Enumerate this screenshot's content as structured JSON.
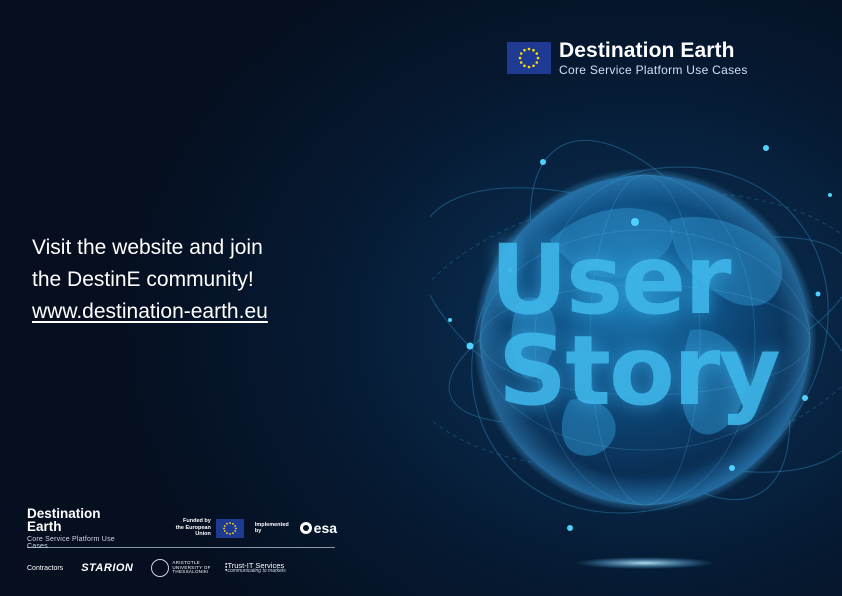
{
  "header": {
    "title": "Destination Earth",
    "subtitle": "Core Service Platform Use Cases",
    "flag_icon": "eu-flag-icon"
  },
  "cta": {
    "line1": "Visit the website and join",
    "line2": "the DestinE community!",
    "link": "www.destination-earth.eu"
  },
  "hero": {
    "word1": "User",
    "word2": "Story"
  },
  "footer": {
    "brand_title": "Destination Earth",
    "brand_subtitle": "Core Service Platform Use Cases",
    "funded_line1": "Funded by",
    "funded_line2": "the European Union",
    "implemented": "Implemented by",
    "esa": "esa",
    "contractors_label": "Contractors",
    "starion": "STARION",
    "auth_line1": "ARISTOTLE",
    "auth_line2": "UNIVERSITY OF",
    "auth_line3": "THESSALONIKI",
    "trust_name": "Trust-IT Services",
    "trust_tagline": "communicating to markets"
  },
  "colors": {
    "background": "#061324",
    "accent": "#3fb8ec",
    "eu_blue": "#1f3a93",
    "eu_star": "#ffdd00"
  }
}
